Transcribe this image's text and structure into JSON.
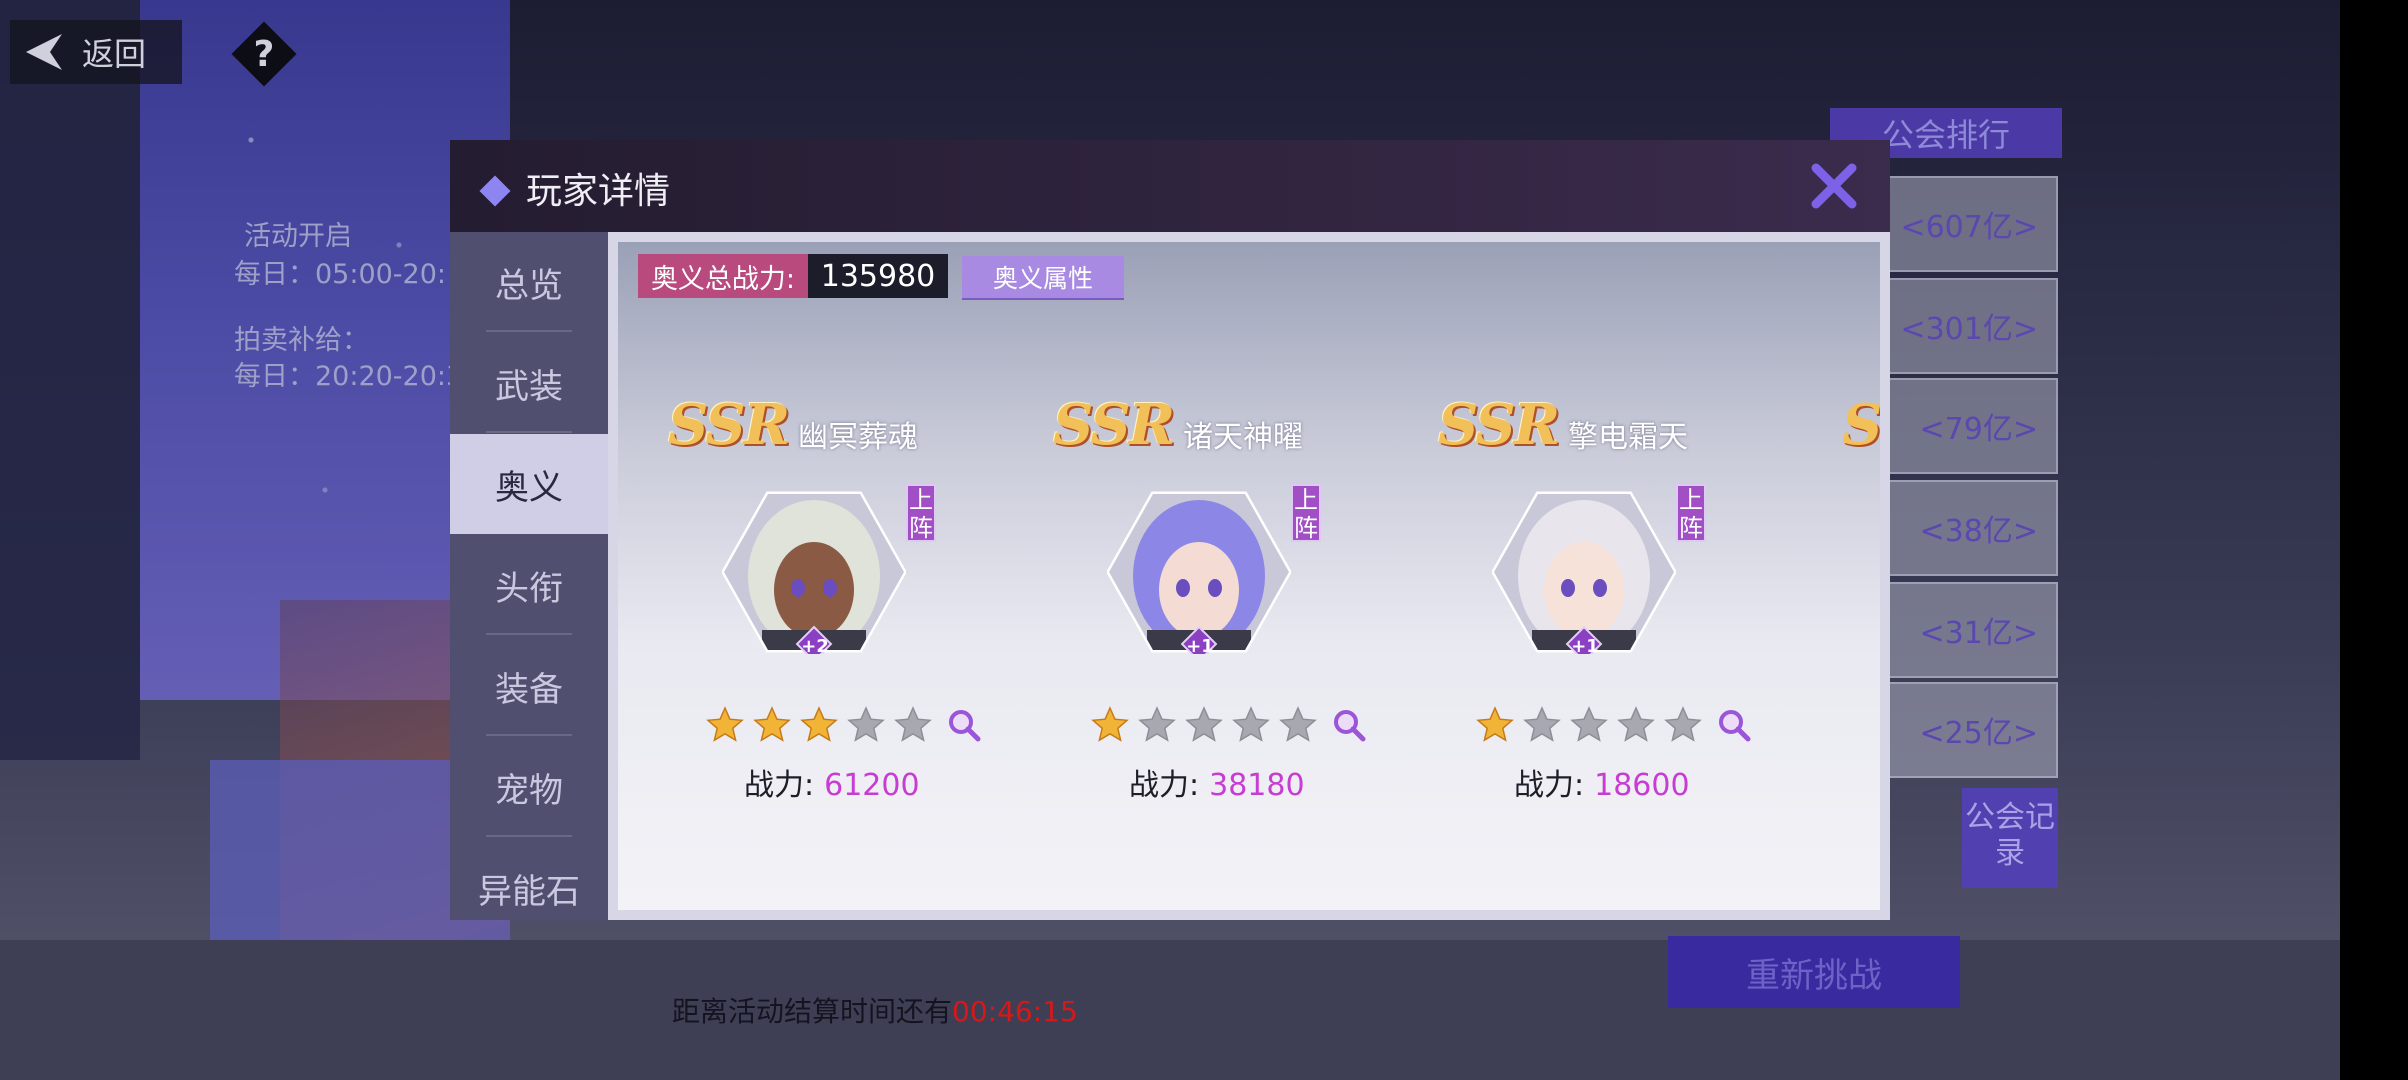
{
  "topbar": {
    "back_label": "返回",
    "help_label": "?"
  },
  "background": {
    "event_open_title": "活动开启",
    "event_open_time": "每日：05:00-20:",
    "auction_title": "拍卖补给：",
    "auction_time": "每日：20:20-20:3",
    "guild_ranking_tab": "公会排行",
    "rankings": [
      "<607亿>",
      "<301亿>",
      "<79亿>",
      "<38亿>",
      "<31亿>",
      "<25亿>"
    ],
    "guild_record_label": "公会记录",
    "rechallenge_label": "重新挑战",
    "countdown_prefix": "距离活动结算时间还有",
    "countdown_time": "00:46:15"
  },
  "modal": {
    "title": "玩家详情",
    "tabs": [
      "总览",
      "武装",
      "奥义",
      "头衔",
      "装备",
      "宠物",
      "异能石"
    ],
    "active_tab": "奥义",
    "total_power_label": "奥义总战力:",
    "total_power_value": "135980",
    "attributes_button": "奥义属性",
    "deploy_tag": "上阵",
    "power_label": "战力:",
    "cards": [
      {
        "rarity": "SSR",
        "name": "幽冥葬魂",
        "level": "+2",
        "stars": 3,
        "max_stars": 5,
        "power": "61200",
        "hair": "#dfe3d9",
        "skin": "#8a5a45"
      },
      {
        "rarity": "SSR",
        "name": "诸天神曜",
        "level": "+1",
        "stars": 1,
        "max_stars": 5,
        "power": "38180",
        "hair": "#8c86e6",
        "skin": "#f4dcd4"
      },
      {
        "rarity": "SSR",
        "name": "擎电霜天",
        "level": "+1",
        "stars": 1,
        "max_stars": 5,
        "power": "18600",
        "hair": "#e8e6ec",
        "skin": "#f7e2da"
      }
    ],
    "partial_card_rarity": "S"
  },
  "colors": {
    "accent": "#8d86f2",
    "power_value": "#c73cd2",
    "countdown": "#d61818",
    "tab_active_bg": "#cfcee6"
  }
}
